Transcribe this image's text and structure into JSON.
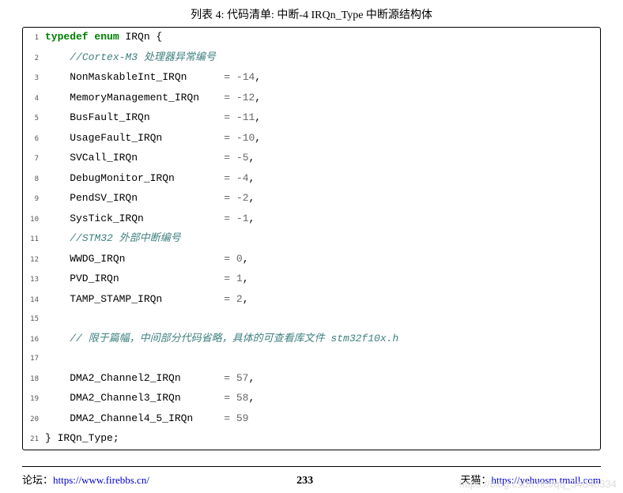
{
  "title": "列表 4: 代码清单: 中断-4 IRQn_Type 中断源结构体",
  "code": {
    "lines": [
      {
        "n": "1",
        "segs": [
          {
            "cls": "kw",
            "t": "typedef enum"
          },
          {
            "cls": "",
            "t": " IRQn {"
          }
        ]
      },
      {
        "n": "2",
        "segs": [
          {
            "cls": "",
            "t": "    "
          },
          {
            "cls": "cm",
            "t": "//Cortex-M3 处理器异常编号"
          }
        ]
      },
      {
        "n": "3",
        "segs": [
          {
            "cls": "",
            "t": "    NonMaskableInt_IRQn      "
          },
          {
            "cls": "op",
            "t": "="
          },
          {
            "cls": "",
            "t": " "
          },
          {
            "cls": "op",
            "t": "-"
          },
          {
            "cls": "num",
            "t": "14"
          },
          {
            "cls": "",
            "t": ","
          }
        ]
      },
      {
        "n": "4",
        "segs": [
          {
            "cls": "",
            "t": "    MemoryManagement_IRQn    "
          },
          {
            "cls": "op",
            "t": "="
          },
          {
            "cls": "",
            "t": " "
          },
          {
            "cls": "op",
            "t": "-"
          },
          {
            "cls": "num",
            "t": "12"
          },
          {
            "cls": "",
            "t": ","
          }
        ]
      },
      {
        "n": "5",
        "segs": [
          {
            "cls": "",
            "t": "    BusFault_IRQn            "
          },
          {
            "cls": "op",
            "t": "="
          },
          {
            "cls": "",
            "t": " "
          },
          {
            "cls": "op",
            "t": "-"
          },
          {
            "cls": "num",
            "t": "11"
          },
          {
            "cls": "",
            "t": ","
          }
        ]
      },
      {
        "n": "6",
        "segs": [
          {
            "cls": "",
            "t": "    UsageFault_IRQn          "
          },
          {
            "cls": "op",
            "t": "="
          },
          {
            "cls": "",
            "t": " "
          },
          {
            "cls": "op",
            "t": "-"
          },
          {
            "cls": "num",
            "t": "10"
          },
          {
            "cls": "",
            "t": ","
          }
        ]
      },
      {
        "n": "7",
        "segs": [
          {
            "cls": "",
            "t": "    SVCall_IRQn              "
          },
          {
            "cls": "op",
            "t": "="
          },
          {
            "cls": "",
            "t": " "
          },
          {
            "cls": "op",
            "t": "-"
          },
          {
            "cls": "num",
            "t": "5"
          },
          {
            "cls": "",
            "t": ","
          }
        ]
      },
      {
        "n": "8",
        "segs": [
          {
            "cls": "",
            "t": "    DebugMonitor_IRQn        "
          },
          {
            "cls": "op",
            "t": "="
          },
          {
            "cls": "",
            "t": " "
          },
          {
            "cls": "op",
            "t": "-"
          },
          {
            "cls": "num",
            "t": "4"
          },
          {
            "cls": "",
            "t": ","
          }
        ]
      },
      {
        "n": "9",
        "segs": [
          {
            "cls": "",
            "t": "    PendSV_IRQn              "
          },
          {
            "cls": "op",
            "t": "="
          },
          {
            "cls": "",
            "t": " "
          },
          {
            "cls": "op",
            "t": "-"
          },
          {
            "cls": "num",
            "t": "2"
          },
          {
            "cls": "",
            "t": ","
          }
        ]
      },
      {
        "n": "10",
        "segs": [
          {
            "cls": "",
            "t": "    SysTick_IRQn             "
          },
          {
            "cls": "op",
            "t": "="
          },
          {
            "cls": "",
            "t": " "
          },
          {
            "cls": "op",
            "t": "-"
          },
          {
            "cls": "num",
            "t": "1"
          },
          {
            "cls": "",
            "t": ","
          }
        ]
      },
      {
        "n": "11",
        "segs": [
          {
            "cls": "",
            "t": "    "
          },
          {
            "cls": "cm",
            "t": "//STM32 外部中断编号"
          }
        ]
      },
      {
        "n": "12",
        "segs": [
          {
            "cls": "",
            "t": "    WWDG_IRQn                "
          },
          {
            "cls": "op",
            "t": "="
          },
          {
            "cls": "",
            "t": " "
          },
          {
            "cls": "num",
            "t": "0"
          },
          {
            "cls": "",
            "t": ","
          }
        ]
      },
      {
        "n": "13",
        "segs": [
          {
            "cls": "",
            "t": "    PVD_IRQn                 "
          },
          {
            "cls": "op",
            "t": "="
          },
          {
            "cls": "",
            "t": " "
          },
          {
            "cls": "num",
            "t": "1"
          },
          {
            "cls": "",
            "t": ","
          }
        ]
      },
      {
        "n": "14",
        "segs": [
          {
            "cls": "",
            "t": "    TAMP_STAMP_IRQn          "
          },
          {
            "cls": "op",
            "t": "="
          },
          {
            "cls": "",
            "t": " "
          },
          {
            "cls": "num",
            "t": "2"
          },
          {
            "cls": "",
            "t": ","
          }
        ]
      },
      {
        "n": "15",
        "segs": [
          {
            "cls": "",
            "t": ""
          }
        ]
      },
      {
        "n": "16",
        "segs": [
          {
            "cls": "",
            "t": "    "
          },
          {
            "cls": "cm",
            "t": "// 限于篇幅，中间部分代码省略，具体的可查看库文件 stm32f10x.h"
          }
        ]
      },
      {
        "n": "17",
        "segs": [
          {
            "cls": "",
            "t": ""
          }
        ]
      },
      {
        "n": "18",
        "segs": [
          {
            "cls": "",
            "t": "    DMA2_Channel2_IRQn       "
          },
          {
            "cls": "op",
            "t": "="
          },
          {
            "cls": "",
            "t": " "
          },
          {
            "cls": "num",
            "t": "57"
          },
          {
            "cls": "",
            "t": ","
          }
        ]
      },
      {
        "n": "19",
        "segs": [
          {
            "cls": "",
            "t": "    DMA2_Channel3_IRQn       "
          },
          {
            "cls": "op",
            "t": "="
          },
          {
            "cls": "",
            "t": " "
          },
          {
            "cls": "num",
            "t": "58"
          },
          {
            "cls": "",
            "t": ","
          }
        ]
      },
      {
        "n": "20",
        "segs": [
          {
            "cls": "",
            "t": "    DMA2_Channel4_5_IRQn     "
          },
          {
            "cls": "op",
            "t": "="
          },
          {
            "cls": "",
            "t": " "
          },
          {
            "cls": "num",
            "t": "59"
          }
        ]
      },
      {
        "n": "21",
        "segs": [
          {
            "cls": "",
            "t": "} IRQn_Type;"
          }
        ]
      }
    ]
  },
  "footer": {
    "forum_label": "论坛：",
    "forum_url": "https://www.firebbs.cn/",
    "page": "233",
    "tmall_label": "天猫：",
    "tmall_url": "https://yehuosm.tmall.com"
  },
  "watermark": "https://blog.csdn.net/qq_34848334"
}
